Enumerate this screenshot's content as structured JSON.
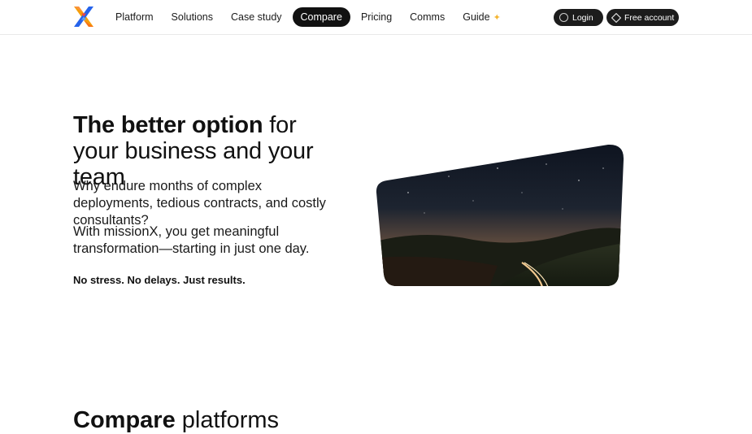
{
  "nav": {
    "items": [
      {
        "label": "Platform"
      },
      {
        "label": "Solutions"
      },
      {
        "label": "Case study"
      },
      {
        "label": "Compare"
      },
      {
        "label": "Pricing"
      },
      {
        "label": "Comms"
      },
      {
        "label": "Guide"
      }
    ],
    "active": "Compare",
    "guide_badge_icon": "sparkle-icon"
  },
  "auth": {
    "login_label": "Login",
    "login_icon": "user-circle-icon",
    "free_label": "Free account",
    "free_icon": "diamond-icon"
  },
  "hero": {
    "title_bold": "The better option",
    "title_light": " for your business and your team",
    "paragraph1": "Why endure months of complex deployments, tedious contracts, and costly consultants?",
    "paragraph2": "With missionX, you get meaningful transformation—starting in just one day.",
    "tagline": "No stress. No delays. Just results.",
    "image": "night-sky-road-photo"
  },
  "section": {
    "title_bold": "Compare",
    "title_light": " platforms"
  },
  "colors": {
    "button_bg": "#1c1c1c",
    "logo_blue": "#3b82f6",
    "logo_orange": "#f97316",
    "sparkle": "#f5b531"
  }
}
